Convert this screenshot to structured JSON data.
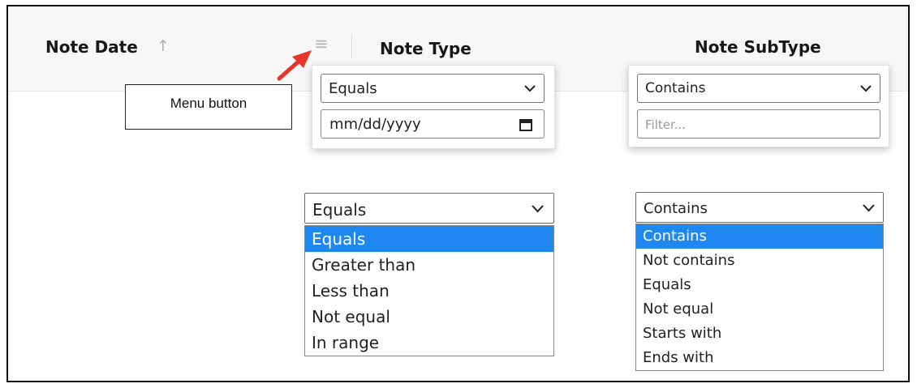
{
  "grid": {
    "columns": [
      {
        "label": "Note Date",
        "sort_icon": "sort-ascending-icon"
      },
      {
        "label": "Note Type",
        "menu_icon": "menu-icon"
      },
      {
        "label": "Note SubType"
      }
    ]
  },
  "annotation": {
    "callout_text": "Menu button",
    "arrow_color": "#e8352b"
  },
  "date_filter_popup": {
    "operator": "Equals",
    "date_placeholder": "mm/dd/yyyy"
  },
  "text_filter_popup": {
    "operator": "Contains",
    "filter_placeholder": "Filter..."
  },
  "date_operator_dropdown": {
    "selected": "Equals",
    "options": [
      "Equals",
      "Greater than",
      "Less than",
      "Not equal",
      "In range"
    ],
    "highlighted_index": 0
  },
  "text_operator_dropdown": {
    "selected": "Contains",
    "options": [
      "Contains",
      "Not contains",
      "Equals",
      "Not equal",
      "Starts with",
      "Ends with"
    ],
    "highlighted_index": 0
  },
  "colors": {
    "highlight": "#1e88f0",
    "header_bg": "#f7f7f7"
  }
}
